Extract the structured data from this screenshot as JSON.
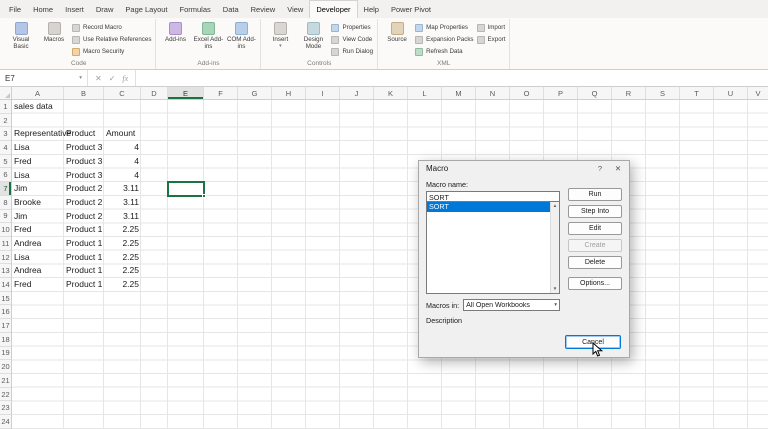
{
  "menu": {
    "tabs": [
      "File",
      "Home",
      "Insert",
      "Draw",
      "Page Layout",
      "Formulas",
      "Data",
      "Review",
      "View",
      "Developer",
      "Help",
      "Power Pivot"
    ]
  },
  "glyphs": {
    "dropdown": "▾",
    "up_arrow": "▲",
    "down_arrow": "▼",
    "help": "?",
    "close": "✕",
    "cancel_x": "✕",
    "check": "✓",
    "fx": "fx"
  },
  "ribbon": {
    "code": {
      "label": "Code",
      "visual_basic": "Visual Basic",
      "macros": "Macros",
      "record_macro": "Record Macro",
      "use_relative_references": "Use Relative References",
      "macro_security": "Macro Security"
    },
    "addins": {
      "label": "Add-ins",
      "addins": "Add-ins",
      "excel_addins": "Excel Add-ins",
      "com_addins": "COM Add-ins"
    },
    "controls": {
      "label": "Controls",
      "insert": "Insert",
      "design_mode": "Design Mode",
      "properties": "Properties",
      "view_code": "View Code",
      "run_dialog": "Run Dialog"
    },
    "xml": {
      "label": "XML",
      "source": "Source",
      "map_properties": "Map Properties",
      "expansion_packs": "Expansion Packs",
      "refresh_data": "Refresh Data",
      "import": "Import",
      "export": "Export"
    }
  },
  "formula_bar": {
    "name_box": "E7"
  },
  "spreadsheet": {
    "columns": [
      "A",
      "B",
      "C",
      "D",
      "E",
      "F",
      "G",
      "H",
      "I",
      "J",
      "K",
      "L",
      "M",
      "N",
      "O",
      "P",
      "Q",
      "R",
      "S",
      "T",
      "U",
      "V"
    ],
    "row_count": 24,
    "selected_cell": "E7",
    "cells": [
      {
        "ref": "A1",
        "value": "sales data"
      },
      {
        "ref": "A3",
        "value": "Representative"
      },
      {
        "ref": "B3",
        "value": "Product"
      },
      {
        "ref": "C3",
        "value": "Amount"
      },
      {
        "ref": "A4",
        "value": "Lisa"
      },
      {
        "ref": "B4",
        "value": "Product 3"
      },
      {
        "ref": "C4",
        "value": "4",
        "align": "right"
      },
      {
        "ref": "A5",
        "value": "Fred"
      },
      {
        "ref": "B5",
        "value": "Product 3"
      },
      {
        "ref": "C5",
        "value": "4",
        "align": "right"
      },
      {
        "ref": "A6",
        "value": "Lisa"
      },
      {
        "ref": "B6",
        "value": "Product 3"
      },
      {
        "ref": "C6",
        "value": "4",
        "align": "right"
      },
      {
        "ref": "A7",
        "value": "Jim"
      },
      {
        "ref": "B7",
        "value": "Product 2"
      },
      {
        "ref": "C7",
        "value": "3.11",
        "align": "right"
      },
      {
        "ref": "A8",
        "value": "Brooke"
      },
      {
        "ref": "B8",
        "value": "Product 2"
      },
      {
        "ref": "C8",
        "value": "3.11",
        "align": "right"
      },
      {
        "ref": "A9",
        "value": "Jim"
      },
      {
        "ref": "B9",
        "value": "Product 2"
      },
      {
        "ref": "C9",
        "value": "3.11",
        "align": "right"
      },
      {
        "ref": "A10",
        "value": "Fred"
      },
      {
        "ref": "B10",
        "value": "Product 1"
      },
      {
        "ref": "C10",
        "value": "2.25",
        "align": "right"
      },
      {
        "ref": "A11",
        "value": "Andrea"
      },
      {
        "ref": "B11",
        "value": "Product 1"
      },
      {
        "ref": "C11",
        "value": "2.25",
        "align": "right"
      },
      {
        "ref": "A12",
        "value": "Lisa"
      },
      {
        "ref": "B12",
        "value": "Product 1"
      },
      {
        "ref": "C12",
        "value": "2.25",
        "align": "right"
      },
      {
        "ref": "A13",
        "value": "Andrea"
      },
      {
        "ref": "B13",
        "value": "Product 1"
      },
      {
        "ref": "C13",
        "value": "2.25",
        "align": "right"
      },
      {
        "ref": "A14",
        "value": "Fred"
      },
      {
        "ref": "B14",
        "value": "Product 1"
      },
      {
        "ref": "C14",
        "value": "2.25",
        "align": "right"
      }
    ]
  },
  "dialog": {
    "title": "Macro",
    "macro_name_label": "Macro name:",
    "macro_name_value": "SORT",
    "list_items": [
      "SORT"
    ],
    "run": "Run",
    "step_into": "Step Into",
    "edit": "Edit",
    "create": "Create",
    "delete": "Delete",
    "options": "Options...",
    "cancel": "Cancel",
    "macros_in_label": "Macros in:",
    "macros_in_value": "All Open Workbooks",
    "description_label": "Description"
  }
}
